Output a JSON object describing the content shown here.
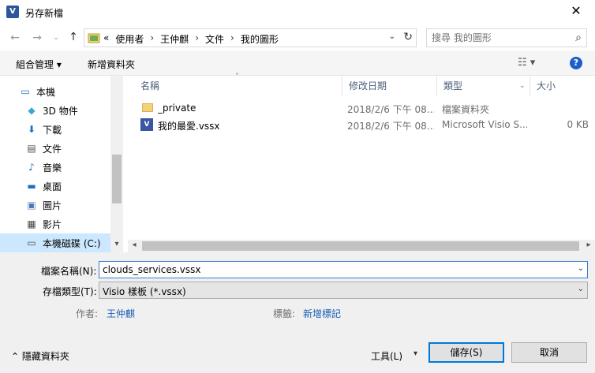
{
  "window": {
    "title": "另存新檔",
    "app_icon": "V"
  },
  "address": {
    "overflow": "«",
    "crumbs": [
      "使用者",
      "王仲麒",
      "文件",
      "我的圖形"
    ]
  },
  "search": {
    "placeholder": "搜尋 我的圖形"
  },
  "toolbar": {
    "organize": "組合管理 ▾",
    "new_folder": "新增資料夾"
  },
  "nav": {
    "items": [
      {
        "label": "本機",
        "icon": "computer-icon"
      },
      {
        "label": "3D 物件",
        "icon": "cube-icon"
      },
      {
        "label": "下載",
        "icon": "download-icon"
      },
      {
        "label": "文件",
        "icon": "document-icon"
      },
      {
        "label": "音樂",
        "icon": "music-icon"
      },
      {
        "label": "桌面",
        "icon": "desktop-icon"
      },
      {
        "label": "圖片",
        "icon": "picture-icon"
      },
      {
        "label": "影片",
        "icon": "video-icon"
      },
      {
        "label": "本機磁碟 (C:)",
        "icon": "drive-icon"
      }
    ]
  },
  "columns": {
    "name": "名稱",
    "date": "修改日期",
    "type": "類型",
    "size": "大小"
  },
  "files": [
    {
      "name": "_private",
      "date": "2018/2/6 下午 08...",
      "type": "檔案資料夾",
      "size": "",
      "icon": "folder-icon"
    },
    {
      "name": "我的最愛.vssx",
      "date": "2018/2/6 下午 08...",
      "type": "Microsoft Visio S...",
      "size": "0 KB",
      "icon": "visio-file-icon"
    }
  ],
  "form": {
    "filename_label": "檔案名稱(N):",
    "filename_value": "clouds_services.vssx",
    "filetype_label": "存檔類型(T):",
    "filetype_value": "Visio 樣板 (*.vssx)",
    "author_label": "作者:",
    "author_value": "王仲麒",
    "tags_label": "標籤:",
    "tags_value": "新增標記"
  },
  "footer": {
    "hide_folders": "隱藏資料夾",
    "tools": "工具(L)",
    "save": "儲存(S)",
    "cancel": "取消"
  }
}
